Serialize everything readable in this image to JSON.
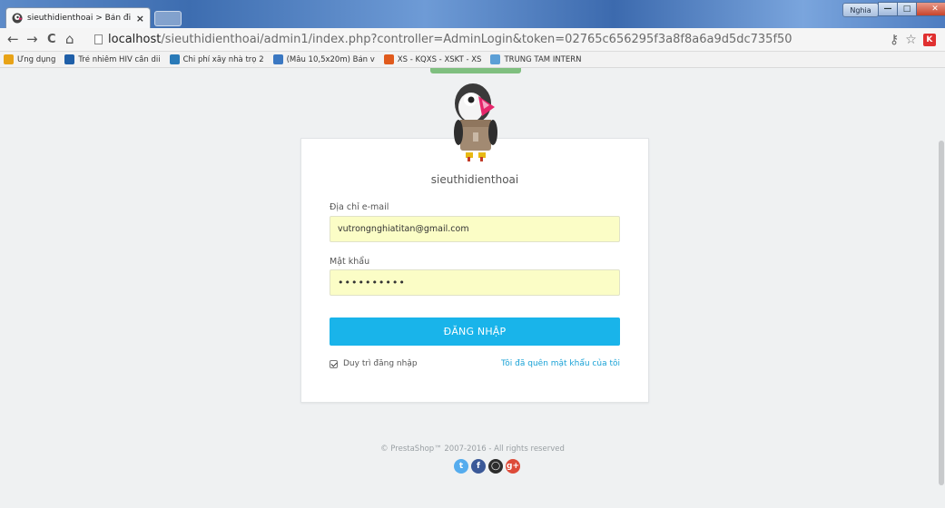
{
  "browser": {
    "tab_title": "sieuthidienthoai > Bản đi",
    "tab_close": "×",
    "user_badge": "Nghia",
    "window_buttons": {
      "minimize": "—",
      "maximize": "□",
      "close": "✕"
    },
    "url_host": "localhost",
    "url_path": "/sieuthidienthoai/admin1/index.php?controller=AdminLogin&token=02765c656295f3a8f8a6a9d5dc735f50",
    "nav": {
      "back": "←",
      "forward": "→",
      "reload": "C",
      "home": "⌂"
    },
    "icons": {
      "key": "key-icon",
      "star": "star-icon",
      "extension": "extension-icon",
      "menu": "menu-icon"
    },
    "extension_label": "K"
  },
  "bookmarks": [
    {
      "label": "Ứng dụng",
      "icon": "apps-icon",
      "color": "#e8a317"
    },
    {
      "label": "Trẻ nhiễm HIV cần dii",
      "icon": "news-icon",
      "color": "#1f5fa8"
    },
    {
      "label": "Chi phí xây nhà trọ 2",
      "icon": "home-icon",
      "color": "#2a7ab8"
    },
    {
      "label": "(Mẫu 10,5x20m) Bản v",
      "icon": "image-icon",
      "color": "#3b78c2"
    },
    {
      "label": "XS - KQXS - XSKT - XS",
      "icon": "lottery-icon",
      "color": "#e05a1c"
    },
    {
      "label": "TRUNG TÂM INTERN",
      "icon": "landscape-icon",
      "color": "#5c9fd6"
    }
  ],
  "login": {
    "shop_name": "sieuthidienthoai",
    "email_label": "Địa chỉ e-mail",
    "email_value": "vutrongnghiatitan@gmail.com",
    "password_label": "Mật khẩu",
    "password_value": "••••••••••",
    "submit_label": "ĐĂNG NHẬP",
    "remember_label": "Duy trì đăng nhập",
    "remember_checked": true,
    "forgot_label": "Tôi đã quên mật khẩu của tôi"
  },
  "footer": {
    "copyright": "© PrestaShop™ 2007-2016 - All rights reserved",
    "social": [
      {
        "icon": "twitter-icon",
        "glyph": "t",
        "color": "#55acee"
      },
      {
        "icon": "facebook-icon",
        "glyph": "f",
        "color": "#3b5998"
      },
      {
        "icon": "github-icon",
        "glyph": "◯",
        "color": "#2d2d2d"
      },
      {
        "icon": "google-plus-icon",
        "glyph": "g+",
        "color": "#dd4b39"
      }
    ]
  },
  "colors": {
    "accent": "#19b4ea",
    "input_bg": "#fbfdc6",
    "link": "#19a2d6"
  }
}
